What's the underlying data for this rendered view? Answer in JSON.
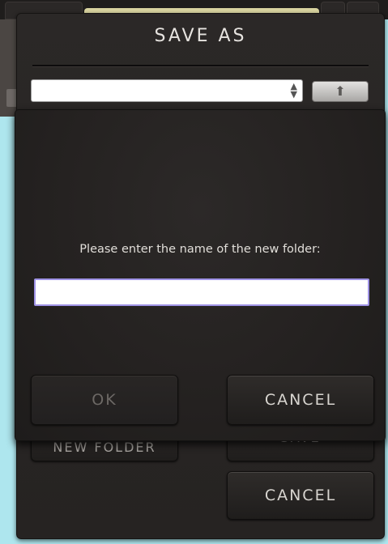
{
  "dialog": {
    "title": "SAVE AS",
    "folder_select_value": "",
    "up_icon": "up-arrow-icon",
    "behind_buttons": {
      "new_folder": "NEW FOLDER",
      "save": "SAVE",
      "cancel": "CANCEL"
    }
  },
  "new_folder_modal": {
    "prompt": "Please enter the name of the new folder:",
    "folder_name_value": "",
    "ok_label": "OK",
    "cancel_label": "CANCEL",
    "input_focus_color": "#9f93e6"
  }
}
